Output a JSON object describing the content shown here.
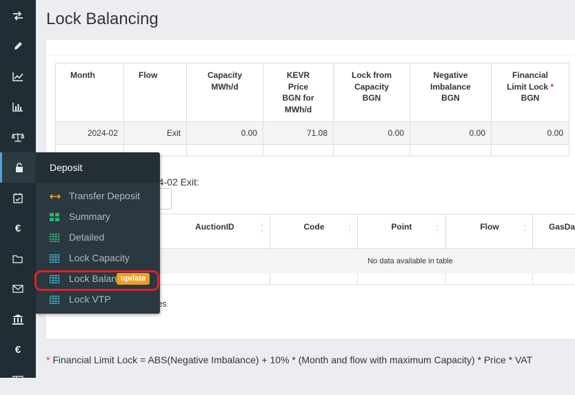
{
  "page": {
    "title": "Lock Balancing"
  },
  "sidebar": {
    "icons": [
      "transfer-icon",
      "pencil-icon",
      "line-chart-icon",
      "bar-chart-icon",
      "balance-scale-icon",
      "unlock-icon",
      "calendar-check-icon",
      "euro-icon",
      "folder-open-icon",
      "envelope-icon",
      "bank-icon",
      "euro-icon",
      "table-icon"
    ],
    "active": "unlock-icon"
  },
  "balance_table": {
    "headers": {
      "month": "Month",
      "flow": "Flow",
      "capacity": [
        "Capacity",
        "MWh/d"
      ],
      "kevr": [
        "KEVR",
        "Price",
        "BGN for",
        "MWh/d"
      ],
      "lock_capacity": [
        "Lock from",
        "Capacity",
        "BGN"
      ],
      "negative": [
        "Negative",
        "Imbalance",
        "BGN"
      ],
      "financial": [
        "Financial",
        "Limit Lock",
        "BGN"
      ]
    },
    "required_mark": "*",
    "rows": [
      {
        "month": "2024-02",
        "flow": "Exit",
        "capacity": "0.00",
        "kevr": "71.08",
        "lock_capacity": "0.00",
        "negative": "0.00",
        "financial": "0.00"
      }
    ]
  },
  "filter": {
    "label_partial": "24-02 Exit:",
    "button_partial": "l"
  },
  "auction_table": {
    "columns": [
      "AuctionID",
      "Code",
      "Point",
      "Flow",
      "GasDay"
    ],
    "empty_message": "No data available in table",
    "entries_partial": "es"
  },
  "footnote": {
    "mark": "*",
    "text": "Financial Limit Lock = ABS(Negative Imbalance) + 10% * (Month and flow with maximum Capacity) * Price * VAT"
  },
  "menu": {
    "title": "Deposit",
    "items": [
      {
        "label": "Transfer Deposit",
        "icon": "arrows-horizontal-icon"
      },
      {
        "label": "Summary",
        "icon": "grid-icon"
      },
      {
        "label": "Detailed",
        "icon": "table-icon"
      },
      {
        "label": "Lock Capacity",
        "icon": "table-icon"
      },
      {
        "label": "Lock Balan",
        "icon": "table-icon",
        "badge": "update"
      },
      {
        "label": "Lock VTP",
        "icon": "table-icon"
      }
    ]
  },
  "colors": {
    "sidebar_bg": "#1f2d34",
    "menu_bg": "#2a3840",
    "badge": "#f0a020",
    "highlight": "#e0202a",
    "required": "#d9342b"
  }
}
